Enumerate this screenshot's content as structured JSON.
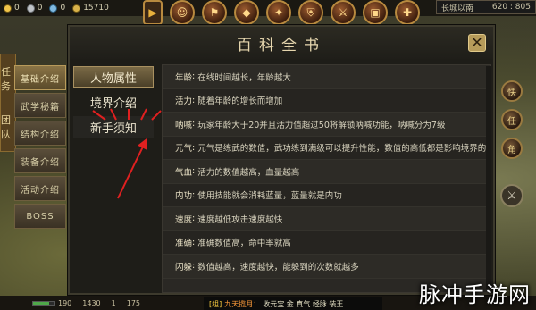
{
  "topbar": {
    "currencies": [
      {
        "icon": "gold-coin-icon",
        "value": "0"
      },
      {
        "icon": "silver-coin-icon",
        "value": "0"
      },
      {
        "icon": "gem-icon",
        "value": "0"
      },
      {
        "icon": "ingot-icon",
        "value": "15710"
      }
    ],
    "location": {
      "name": "长城以南",
      "coords": "620 : 805"
    },
    "icons": [
      "play-arrow-icon",
      "character-icon",
      "banner-icon",
      "gold-ingot-icon",
      "treasure-icon",
      "shield-icon",
      "swords-icon",
      "chest-icon",
      "gift-icon"
    ]
  },
  "left_strip": {
    "tabs": [
      "任务",
      "团队"
    ]
  },
  "category_nav": {
    "items": [
      "基础介绍",
      "武学秘籍",
      "结构介绍",
      "装备介绍",
      "活动介绍",
      "BOSS"
    ],
    "active": 0
  },
  "panel": {
    "title": "百科全书",
    "close_label": "✕",
    "nav": [
      {
        "label": "人物属性",
        "active": true
      },
      {
        "label": "境界介绍",
        "active": false
      },
      {
        "label": "新手须知",
        "active": false
      }
    ],
    "rows": [
      {
        "key": "年龄",
        "text": "在线时间越长，年龄越大"
      },
      {
        "key": "活力",
        "text": "随着年龄的增长而增加"
      },
      {
        "key": "呐喊",
        "text": "玩家年龄大于20并且活力值超过50将解锁呐喊功能，呐喊分为7级"
      },
      {
        "key": "元气",
        "text": "元气是练武的数值，武功练到满级可以提升性能，数值的高低都是影响境界的"
      },
      {
        "key": "气血",
        "text": "活力的数值越高，血量越高"
      },
      {
        "key": "内功",
        "text": "使用技能就会消耗蓝量，蓝量就是内功"
      },
      {
        "key": "速度",
        "text": "速度越低攻击速度越快"
      },
      {
        "key": "准确",
        "text": "准确数值高，命中率就高"
      },
      {
        "key": "闪躲",
        "text": "数值越高，速度越快，能躲到的次数就越多"
      }
    ]
  },
  "right_buttons": [
    "快递-icon",
    "任务-icon",
    "角色-icon",
    "sword-icon"
  ],
  "bottombar": {
    "hp": "190",
    "hp_fill": 0.75,
    "mp": "1430",
    "level": "1",
    "stats": [
      "175"
    ]
  },
  "chat": {
    "tag": "[组]",
    "name": "九天揽月：",
    "message": "收元宝 金 真气 经脉 装王"
  },
  "watermark": "脉冲手游网",
  "colors": {
    "accent": "#b69b5a",
    "title": "#e6d6ae"
  }
}
